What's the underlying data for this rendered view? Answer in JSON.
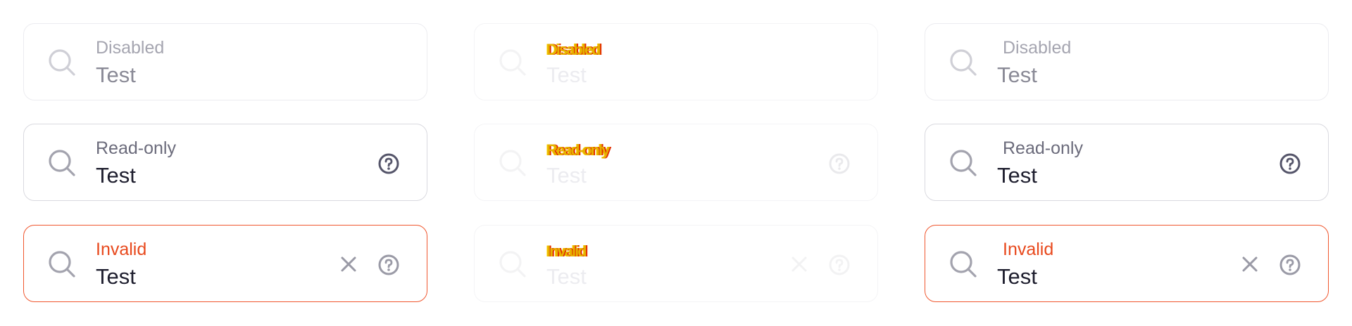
{
  "columns": [
    {
      "fields": [
        {
          "label": "Disabled",
          "value": "Test",
          "state": "disabled"
        },
        {
          "label": "Read-only",
          "value": "Test",
          "state": "readonly"
        },
        {
          "label": "Invalid",
          "value": "Test",
          "state": "invalid"
        }
      ]
    },
    {
      "fields": [
        {
          "label": "Disabled",
          "value": "Test",
          "state": "disabled"
        },
        {
          "label": "Read-only",
          "value": "Test",
          "state": "readonly"
        },
        {
          "label": "Invalid",
          "value": "Test",
          "state": "invalid"
        }
      ]
    },
    {
      "fields": [
        {
          "label": "Disabled",
          "value": "Test",
          "state": "disabled"
        },
        {
          "label": "Read-only",
          "value": "Test",
          "state": "readonly"
        },
        {
          "label": "Invalid",
          "value": "Test",
          "state": "invalid"
        }
      ]
    }
  ],
  "icons": {
    "search": "search-icon",
    "help": "help-circle-icon",
    "clear": "close-icon"
  },
  "colors": {
    "invalid": "#f0562e",
    "border": "#d9d9df",
    "text": "#1e1e2e",
    "label": "#6b6b7b"
  }
}
